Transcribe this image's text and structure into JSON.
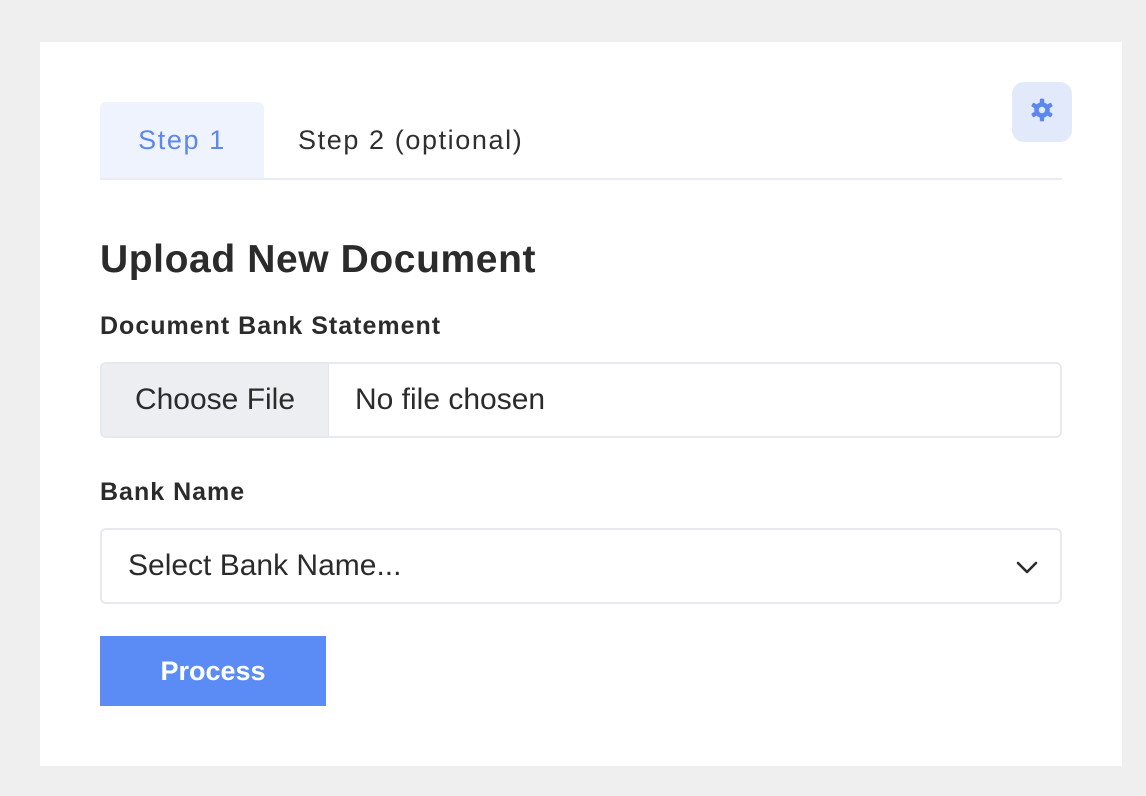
{
  "tabs": [
    {
      "label": "Step 1",
      "active": true
    },
    {
      "label": "Step 2 (optional)",
      "active": false
    }
  ],
  "settings": {
    "icon": "gear-icon",
    "color": "#5b87ee"
  },
  "form": {
    "heading": "Upload New Document",
    "document_label": "Document Bank Statement",
    "file_button_label": "Choose File",
    "file_status": "No file chosen",
    "bank_label": "Bank Name",
    "bank_select_value": "Select Bank Name...",
    "process_label": "Process"
  },
  "colors": {
    "accent": "#5b8cf6",
    "tab_active_bg": "#eef3fd",
    "tab_active_text": "#5b87ee"
  }
}
